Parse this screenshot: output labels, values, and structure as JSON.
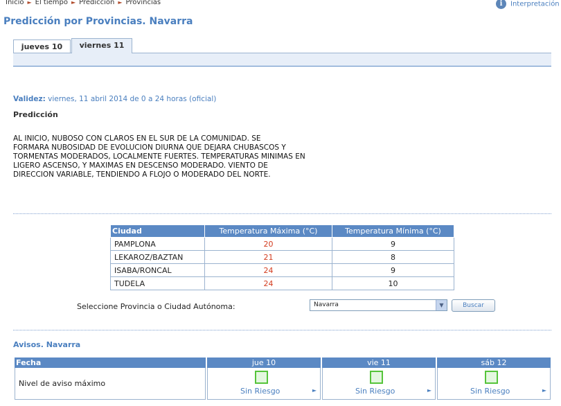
{
  "breadcrumb": [
    "Inicio",
    "El tiempo",
    "Predicción",
    "Provincias"
  ],
  "interpretacion_link": "Interpretación",
  "page_title": "Predicción por Provincias. Navarra",
  "tabs": [
    {
      "label": "jueves 10",
      "active": false
    },
    {
      "label": "viernes 11",
      "active": true
    }
  ],
  "validity": {
    "label": "Validez:",
    "value": "viernes, 11 abril 2014 de 0 a 24 horas (oficial)"
  },
  "prediction": {
    "heading": "Predicción",
    "text": "AL INICIO, NUBOSO CON CLAROS EN EL SUR DE LA COMUNIDAD. SE\nFORMARA NUBOSIDAD DE EVOLUCION DIURNA QUE DEJARA CHUBASCOS Y\nTORMENTAS MODERADOS, LOCALMENTE FUERTES. TEMPERATURAS MINIMAS EN\nLIGERO ASCENSO, Y MAXIMAS EN DESCENSO MODERADO. VIENTO DE\nDIRECCION VARIABLE, TENDIENDO A FLOJO O MODERADO DEL NORTE."
  },
  "temperature_table": {
    "headers": [
      "Ciudad",
      "Temperatura Máxima (°C)",
      "Temperatura Mínima (°C)"
    ],
    "rows": [
      {
        "city": "PAMPLONA",
        "max": "20",
        "min": "9"
      },
      {
        "city": "LEKAROZ/BAZTAN",
        "max": "21",
        "min": "8"
      },
      {
        "city": "ISABA/RONCAL",
        "max": "24",
        "min": "9"
      },
      {
        "city": "TUDELA",
        "max": "24",
        "min": "10"
      }
    ]
  },
  "selector": {
    "label": "Seleccione Provincia o Ciudad Autónoma:",
    "selected": "Navarra",
    "button": "Buscar"
  },
  "avisos": {
    "title": "Avisos. Navarra",
    "header_label": "Fecha",
    "row_label": "Nivel de aviso máximo",
    "days": [
      {
        "label": "jue 10",
        "level": "Sin Riesgo"
      },
      {
        "label": "vie 11",
        "level": "Sin Riesgo"
      },
      {
        "label": "sáb 12",
        "level": "Sin Riesgo"
      }
    ]
  },
  "colors": {
    "accent": "#4a7fbf",
    "header_bg": "#5b89c4",
    "max_temp": "#d33b1e",
    "risk_green": "#55c43a"
  }
}
